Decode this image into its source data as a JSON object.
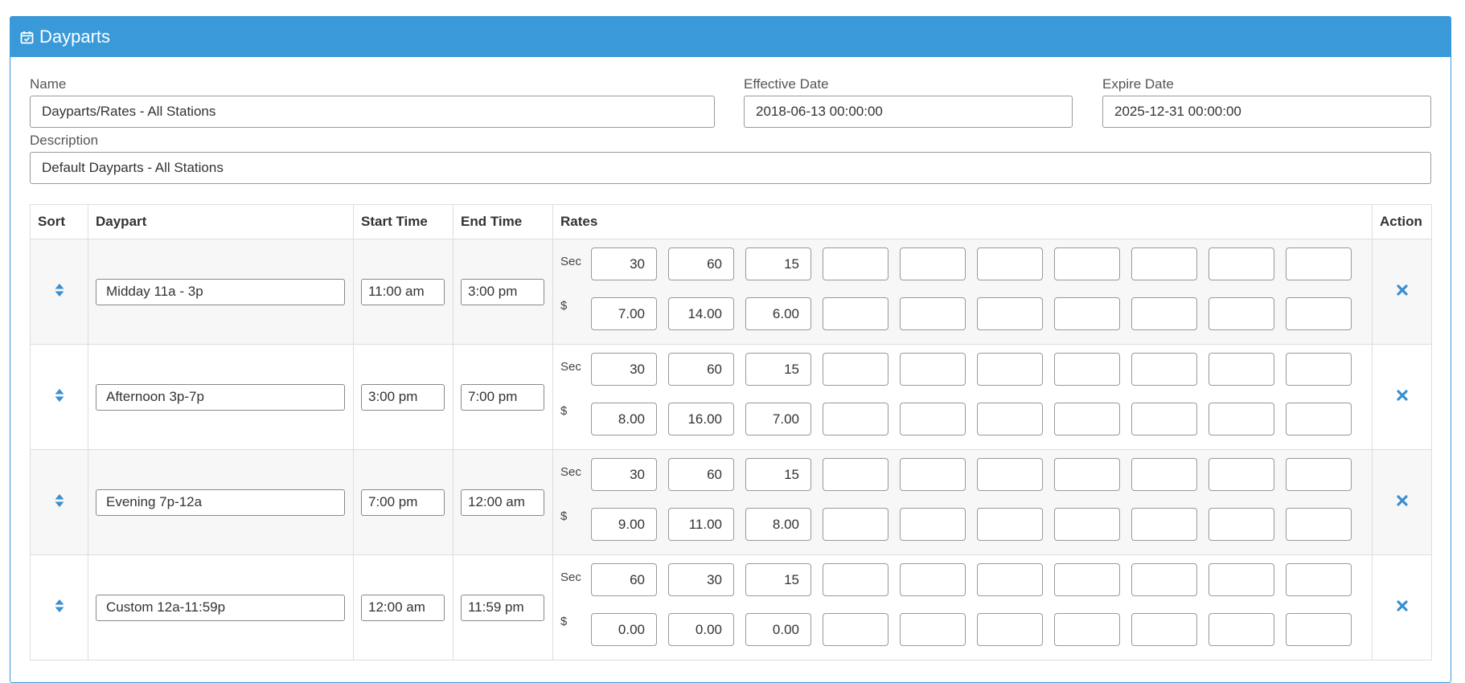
{
  "panel": {
    "title": "Dayparts",
    "icon": "calendar-check-icon",
    "color": "#3a9ad9"
  },
  "form": {
    "name_label": "Name",
    "name_value": "Dayparts/Rates - All Stations",
    "effective_label": "Effective Date",
    "effective_value": "2018-06-13 00:00:00",
    "expire_label": "Expire Date",
    "expire_value": "2025-12-31 00:00:00",
    "description_label": "Description",
    "description_value": "Default Dayparts - All Stations"
  },
  "table": {
    "headers": {
      "sort": "Sort",
      "daypart": "Daypart",
      "start": "Start Time",
      "end": "End Time",
      "rates": "Rates",
      "action": "Action"
    },
    "sec_label": "Sec",
    "price_label": "$",
    "rows": [
      {
        "daypart": "Midday 11a - 3p",
        "start": "11:00 am",
        "end": "3:00 pm",
        "sec": [
          "30",
          "60",
          "15",
          "",
          "",
          "",
          "",
          "",
          "",
          ""
        ],
        "price": [
          "7.00",
          "14.00",
          "6.00",
          "",
          "",
          "",
          "",
          "",
          "",
          ""
        ]
      },
      {
        "daypart": "Afternoon 3p-7p",
        "start": "3:00 pm",
        "end": "7:00 pm",
        "sec": [
          "30",
          "60",
          "15",
          "",
          "",
          "",
          "",
          "",
          "",
          ""
        ],
        "price": [
          "8.00",
          "16.00",
          "7.00",
          "",
          "",
          "",
          "",
          "",
          "",
          ""
        ]
      },
      {
        "daypart": "Evening 7p-12a",
        "start": "7:00 pm",
        "end": "12:00 am",
        "sec": [
          "30",
          "60",
          "15",
          "",
          "",
          "",
          "",
          "",
          "",
          ""
        ],
        "price": [
          "9.00",
          "11.00",
          "8.00",
          "",
          "",
          "",
          "",
          "",
          "",
          ""
        ]
      },
      {
        "daypart": "Custom 12a-11:59p",
        "start": "12:00 am",
        "end": "11:59 pm",
        "sec": [
          "60",
          "30",
          "15",
          "",
          "",
          "",
          "",
          "",
          "",
          ""
        ],
        "price": [
          "0.00",
          "0.00",
          "0.00",
          "",
          "",
          "",
          "",
          "",
          "",
          ""
        ]
      }
    ]
  }
}
